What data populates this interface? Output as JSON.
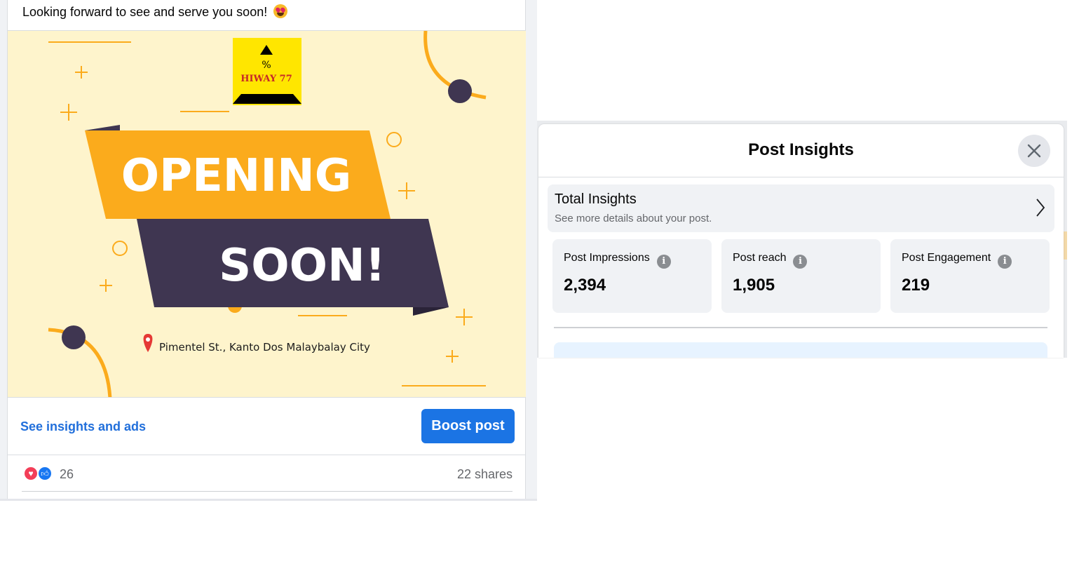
{
  "post": {
    "text": "Looking forward to see and serve you soon!",
    "emoji": "heart-eyes-emoji",
    "image": {
      "logo_text": "HIWAY 77",
      "headline_1": "OPENING",
      "headline_2": "SOON!",
      "location": "Pimentel St., Kanto Dos Malaybalay City",
      "colors": {
        "background": "#fef4cc",
        "accent": "#fbab1c",
        "dark": "#3f3651",
        "logo_bg": "#ffe600",
        "pin": "#e53935"
      }
    },
    "see_insights_label": "See insights and ads",
    "boost_label": "Boost post",
    "reaction_count": "26",
    "shares": "22 shares"
  },
  "insights": {
    "title": "Post Insights",
    "total": {
      "title": "Total Insights",
      "subtitle": "See more details about your post."
    },
    "stats": [
      {
        "label": "Post Impressions",
        "value": "2,394"
      },
      {
        "label": "Post reach",
        "value": "1,905"
      },
      {
        "label": "Post Engagement",
        "value": "219"
      }
    ]
  },
  "colors": {
    "primary": "#1b74e4",
    "link": "#216fdb",
    "muted": "#65676b",
    "card_bg": "#f0f2f5"
  }
}
